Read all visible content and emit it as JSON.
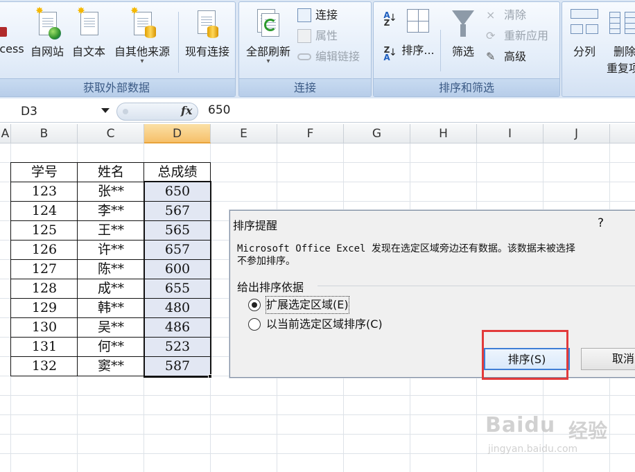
{
  "ribbon": {
    "groups": [
      {
        "label": "获取外部数据"
      },
      {
        "label": "连接"
      },
      {
        "label": "排序和筛选"
      }
    ],
    "buttons": {
      "access": "cess",
      "web": "自网站",
      "text": "自文本",
      "other_sources": "自其他来源",
      "existing_connections": "现有连接",
      "refresh_all": "全部刷新",
      "connections": "连接",
      "properties": "属性",
      "edit_links": "编辑链接",
      "sort": "排序...",
      "filter": "筛选",
      "clear": "清除",
      "reapply": "重新应用",
      "advanced": "高级",
      "text_to_columns": "分列",
      "remove_duplicates_line1": "删除",
      "remove_duplicates_line2": "重复项"
    },
    "sort_az_glyph": {
      "top": "A",
      "bottom": "Z"
    },
    "sort_za_glyph": {
      "top": "Z",
      "bottom": "A"
    }
  },
  "formula_bar": {
    "name_box": "D3",
    "fx_label": "fx",
    "formula": "650"
  },
  "columns": [
    "A",
    "B",
    "C",
    "D",
    "E",
    "F",
    "G",
    "H",
    "I",
    "J"
  ],
  "active_column": "D",
  "table": {
    "headers": [
      "学号",
      "姓名",
      "总成绩"
    ],
    "rows": [
      [
        "123",
        "张**",
        "650"
      ],
      [
        "124",
        "李**",
        "567"
      ],
      [
        "125",
        "王**",
        "565"
      ],
      [
        "126",
        "许**",
        "657"
      ],
      [
        "127",
        "陈**",
        "600"
      ],
      [
        "128",
        "成**",
        "655"
      ],
      [
        "129",
        "韩**",
        "480"
      ],
      [
        "130",
        "吴**",
        "486"
      ],
      [
        "131",
        "何**",
        "523"
      ],
      [
        "132",
        "窦**",
        "587"
      ]
    ]
  },
  "dialog": {
    "title": "排序提醒",
    "help": "?",
    "message_line1": "Microsoft Office Excel 发现在选定区域旁边还有数据。该数据未被选择",
    "message_line2": "不参加排序。",
    "group_label": "给出排序依据",
    "option_expand": "扩展选定区域(E)",
    "option_current": "以当前选定区域排序(C)",
    "selected_option": "expand",
    "sort_button": "排序(S)",
    "cancel_button": "取消"
  },
  "watermark": {
    "brand": "Baidu",
    "cn": "经验",
    "url": "jingyan.baidu.com"
  },
  "colors": {
    "active_column_header": "#f6c06a",
    "selection_fill": "#e2e7f3",
    "highlight_box": "#e23a3a",
    "default_button_border": "#3f7ed6",
    "ribbon_label": "#3b5a85"
  }
}
